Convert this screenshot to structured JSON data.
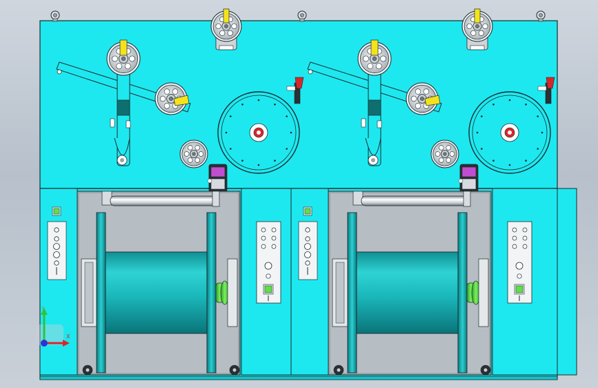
{
  "viewport": {
    "background_top": "#cfd6de",
    "background_bottom": "#b7c0cb"
  },
  "colors": {
    "machine_body": "#1ee8ef",
    "machine_body_dark": "#15c3c9",
    "outline": "#1b2a2e",
    "drum": "#12a9ad",
    "drum_light": "#3fe0df",
    "steel": "#d8dde2",
    "yellow_guard": "#f4e31c",
    "green_accent": "#5ee04a",
    "magenta_accent": "#c04fd0",
    "red_accent": "#d8262b",
    "panel_bg": "#f2f4f5"
  },
  "triad": {
    "x_label": "X",
    "y_label": "Y",
    "x_color": "#d8262b",
    "y_color": "#32c13a",
    "origin_color": "#2a33d8"
  },
  "modules": [
    {
      "id": "left-winder",
      "control_buttons": 6,
      "indicator_lamp": "green"
    },
    {
      "id": "right-winder",
      "control_buttons": 6,
      "indicator_lamp": "green"
    }
  ]
}
